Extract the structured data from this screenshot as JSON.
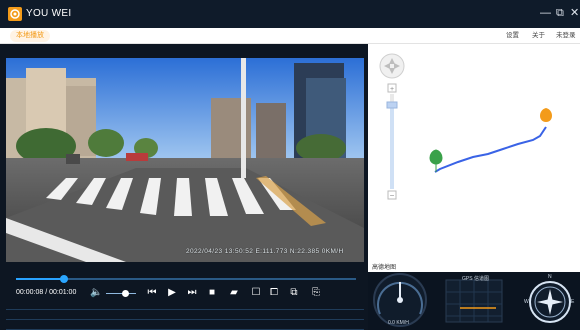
{
  "window": {
    "title": "YOU WEI",
    "minimize": "—",
    "maximize": "⧉",
    "close": "✕"
  },
  "toolbar": {
    "tab_label": "本地播放",
    "menu": [
      "设置",
      "关于",
      "未登录"
    ]
  },
  "video": {
    "osd": "2022/04/23  13:50:52  E:111.773  N:22.385  0KM/H"
  },
  "map": {
    "brand": "高德地图",
    "start_marker": "起",
    "end_marker": "终"
  },
  "player": {
    "time": "00:00:08 / 00:01:00",
    "progress": 0.14
  },
  "gauges": {
    "speed_label": "0.0 KM/H",
    "gps_label": "GPS 信道图",
    "north_label": "N",
    "west_label": "W",
    "east_label": "E"
  },
  "colors": {
    "accent": "#f39b1a",
    "progress": "#29a3ff",
    "route": "#3a63e6",
    "start": "#3aa14a"
  }
}
